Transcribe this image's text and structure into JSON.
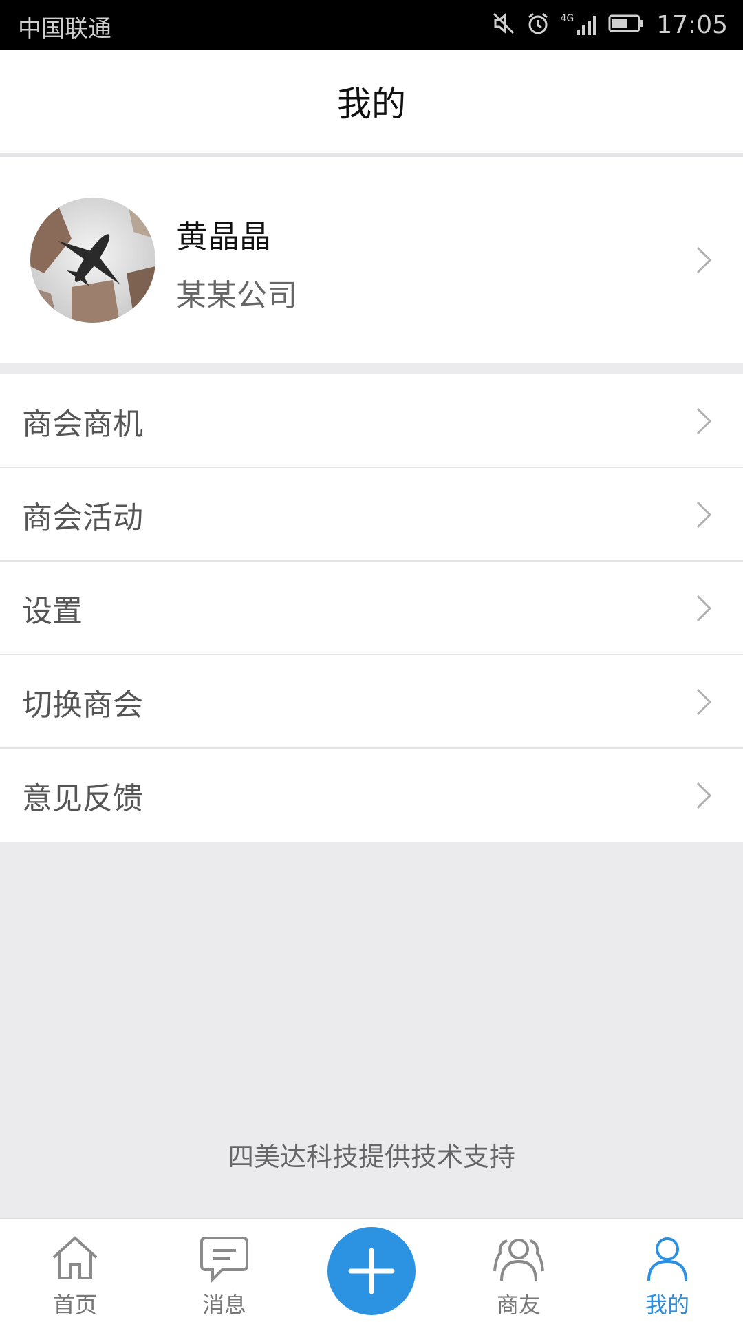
{
  "status_bar": {
    "carrier": "中国联通",
    "network": "4G",
    "time": "17:05"
  },
  "header": {
    "title": "我的"
  },
  "profile": {
    "name": "黄晶晶",
    "company": "某某公司"
  },
  "menu": {
    "items": [
      {
        "label": "商会商机"
      },
      {
        "label": "商会活动"
      },
      {
        "label": "设置"
      },
      {
        "label": "切换商会"
      },
      {
        "label": "意见反馈"
      }
    ]
  },
  "footer": {
    "text": "四美达科技提供技术支持"
  },
  "tabbar": {
    "tabs": [
      {
        "label": "首页",
        "icon": "home-icon"
      },
      {
        "label": "消息",
        "icon": "message-icon"
      },
      {
        "label": "",
        "icon": "plus-icon"
      },
      {
        "label": "商友",
        "icon": "friends-icon"
      },
      {
        "label": "我的",
        "icon": "profile-icon"
      }
    ],
    "active_index": 4
  },
  "colors": {
    "accent": "#2c93e3",
    "background": "#ebebed"
  }
}
